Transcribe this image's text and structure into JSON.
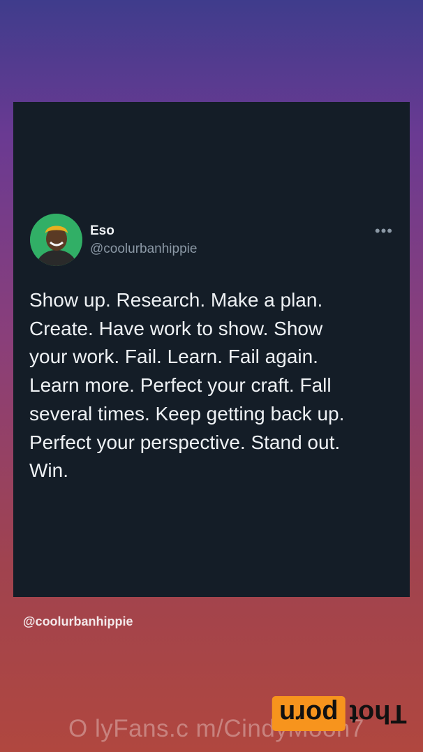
{
  "tweet": {
    "display_name": "Eso",
    "handle": "@coolurbanhippie",
    "more_icon": "more-icon",
    "text": "Show up. Research. Make a plan.\nCreate. Have work to show. Show\nyour work. Fail. Learn. Fail again.\nLearn more. Perfect your craft. Fall\nseveral times. Keep getting back up.\nPerfect your perspective. Stand out.\nWin."
  },
  "caption": "@coolurbanhippie",
  "watermark": "O lyFans.c m/CindyMoon7",
  "logo": {
    "part1": "Thot",
    "part2": "porn"
  },
  "colors": {
    "card_bg": "#141d27",
    "text": "#eef1f4",
    "muted": "#8b98a5",
    "logo_accent": "#f7941d"
  }
}
